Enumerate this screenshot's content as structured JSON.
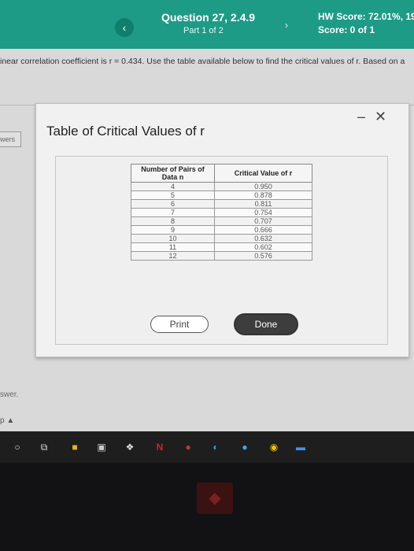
{
  "header": {
    "back_icon": "chevron-left",
    "question_title": "Question 27, 2.4.9",
    "question_sub": "Part 1 of 2",
    "next_icon": "chevron-right",
    "hw_score": "HW Score: 72.01%, 19",
    "score": "Score: 0 of 1"
  },
  "question": {
    "text": "inear correlation coefficient is r = 0.434. Use the table available below to find the critical values of r. Based on a"
  },
  "side": {
    "answers_tab": "wers",
    "answer_text": "swer.",
    "arrow_text": "p ▲"
  },
  "modal": {
    "title": "Table of Critical Values of r",
    "minimize_glyph": "–",
    "close_glyph": "✕",
    "table": {
      "headers": [
        "Number of Pairs of Data n",
        "Critical Value of r"
      ],
      "rows": [
        [
          "4",
          "0.950"
        ],
        [
          "5",
          "0.878"
        ],
        [
          "6",
          "0.811"
        ],
        [
          "7",
          "0.754"
        ],
        [
          "8",
          "0.707"
        ],
        [
          "9",
          "0.666"
        ],
        [
          "10",
          "0.632"
        ],
        [
          "11",
          "0.602"
        ],
        [
          "12",
          "0.576"
        ]
      ]
    },
    "print_label": "Print",
    "done_label": "Done"
  },
  "taskbar": {
    "icons": [
      "search-icon",
      "task-view-icon",
      "file-explorer-icon",
      "store-icon",
      "dropbox-icon",
      "netflix-icon",
      "app-icon",
      "edge-icon",
      "app-blue-icon",
      "chrome-icon",
      "app-blue-icon-2"
    ]
  },
  "colors": {
    "header": "#1d9b87",
    "done_button": "#3d3d3d",
    "taskbar": "#1e1e1f"
  }
}
